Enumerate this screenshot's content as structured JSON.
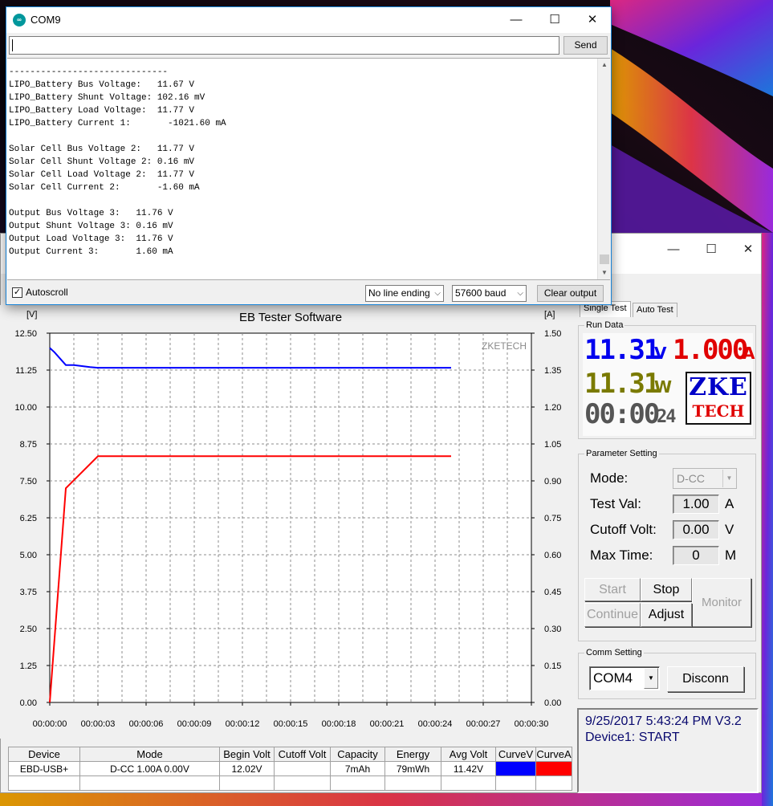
{
  "serial": {
    "title": "COM9",
    "icon": "arduino-icon",
    "window_controls": {
      "minimize": "—",
      "maximize": "☐",
      "close": "✕"
    },
    "input_value": "",
    "send_label": "Send",
    "lines": [
      "------------------------------",
      "LIPO_Battery Bus Voltage:   11.67 V",
      "LIPO_Battery Shunt Voltage: 102.16 mV",
      "LIPO_Battery Load Voltage:  11.77 V",
      "LIPO_Battery Current 1:       -1021.60 mA",
      "",
      "Solar Cell Bus Voltage 2:   11.77 V",
      "Solar Cell Shunt Voltage 2: 0.16 mV",
      "Solar Cell Load Voltage 2:  11.77 V",
      "Solar Cell Current 2:       -1.60 mA",
      "",
      "Output Bus Voltage 3:   11.76 V",
      "Output Shunt Voltage 3: 0.16 mV",
      "Output Load Voltage 3:  11.76 V",
      "Output Current 3:       1.60 mA"
    ],
    "autoscroll_label": "Autoscroll",
    "autoscroll_checked": true,
    "line_ending": "No line ending",
    "baud": "57600 baud",
    "clear_label": "Clear output"
  },
  "eb": {
    "window_controls": {
      "minimize": "—",
      "maximize": "☐",
      "close": "✕"
    },
    "tabs": [
      {
        "label": "Single Test",
        "active": true
      },
      {
        "label": "Auto Test",
        "active": false
      }
    ],
    "run_data_label": "Run Data",
    "voltage": "11.31",
    "voltage_unit": "V",
    "current": "1.000",
    "current_unit": "A",
    "power": "11.31",
    "power_unit": "W",
    "time_main": "00:00",
    "time_sec": "24",
    "logo_top": "ZKE",
    "logo_bottom": "TECH",
    "param_label": "Parameter Setting",
    "mode_label": "Mode:",
    "mode_value": "D-CC",
    "test_val_label": "Test Val:",
    "test_val": "1.00",
    "test_val_unit": "A",
    "cutoff_label": "Cutoff Volt:",
    "cutoff_val": "0.00",
    "cutoff_unit": "V",
    "max_time_label": "Max Time:",
    "max_time_val": "0",
    "max_time_unit": "M",
    "buttons": {
      "start": "Start",
      "stop": "Stop",
      "monitor": "Monitor",
      "continue": "Continue",
      "adjust": "Adjust"
    },
    "comm_label": "Comm Setting",
    "comm_port": "COM4",
    "disconn_label": "Disconn",
    "status_line1": "9/25/2017 5:43:24 PM  V3.2",
    "status_line2": "Device1: START",
    "table": {
      "headers": [
        "Device",
        "Mode",
        "Begin Volt",
        "Cutoff Volt",
        "Capacity",
        "Energy",
        "Avg Volt",
        "CurveV",
        "CurveA"
      ],
      "row": [
        "EBD-USB+",
        "D-CC  1.00A  0.00V",
        "12.02V",
        "",
        "7mAh",
        "79mWh",
        "11.42V",
        "",
        ""
      ],
      "curve_colors": [
        "#0000ff",
        "#ff0000"
      ]
    }
  },
  "chart_data": {
    "type": "line",
    "title": "EB Tester Software",
    "watermark": "ZKETECH",
    "ylabel_left": "[V]",
    "ylabel_right": "[A]",
    "ylim_left": [
      0,
      12.5
    ],
    "ylim_right": [
      0,
      1.5
    ],
    "yticks_left": [
      "0.00",
      "1.25",
      "2.50",
      "3.75",
      "5.00",
      "6.25",
      "7.50",
      "8.75",
      "10.00",
      "11.25",
      "12.50"
    ],
    "yticks_right": [
      "0.00",
      "0.15",
      "0.30",
      "0.45",
      "0.60",
      "0.75",
      "0.90",
      "1.05",
      "1.20",
      "1.35",
      "1.50"
    ],
    "xticks": [
      "00:00:00",
      "00:00:03",
      "00:00:06",
      "00:00:09",
      "00:00:12",
      "00:00:15",
      "00:00:18",
      "00:00:21",
      "00:00:24",
      "00:00:27",
      "00:00:30"
    ],
    "xlim": [
      0,
      30
    ],
    "grid": true,
    "series": [
      {
        "name": "CurveV",
        "axis": "left",
        "color": "#0000ff",
        "x": [
          0,
          0.3,
          1,
          1.5,
          2.5,
          3,
          25
        ],
        "y": [
          12.0,
          11.85,
          11.42,
          11.42,
          11.35,
          11.33,
          11.33
        ]
      },
      {
        "name": "CurveA",
        "axis": "right",
        "color": "#ff0000",
        "x": [
          0,
          1,
          3,
          25
        ],
        "y": [
          0.0,
          0.87,
          1.0,
          1.0
        ]
      }
    ]
  }
}
